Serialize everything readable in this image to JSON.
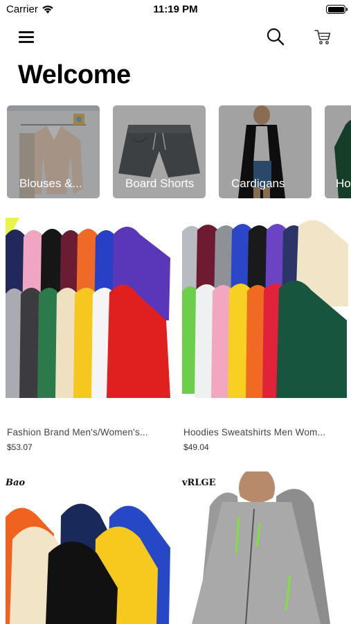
{
  "status_bar": {
    "carrier": "Carrier",
    "time": "11:19 PM"
  },
  "nav": {
    "menu_icon": "hamburger-menu-icon",
    "search_icon": "search-icon",
    "cart_icon": "cart-icon"
  },
  "header": {
    "title": "Welcome"
  },
  "categories": [
    {
      "label": "Blouses &...",
      "image": "blouse-photo"
    },
    {
      "label": "Board Shorts",
      "image": "shorts-photo"
    },
    {
      "label": "Cardigans",
      "image": "cardigan-photo"
    },
    {
      "label": "Ho",
      "image": "hoodie-photo"
    }
  ],
  "products": [
    {
      "title": "Fashion Brand Men's/Women's...",
      "price": "$53.07",
      "image": "hoodie-rack-photo",
      "brand_mark": ""
    },
    {
      "title": "Hoodies Sweatshirts Men Wom...",
      "price": "$49.04",
      "image": "hoodie-rows-photo",
      "brand_mark": ""
    },
    {
      "title": "",
      "price": "",
      "image": "hoodie-stack-photo",
      "brand_mark": "Bao"
    },
    {
      "title": "",
      "price": "",
      "image": "gray-zip-hoodie-photo",
      "brand_mark": "vRLGE"
    }
  ],
  "colors": {
    "background": "#ffffff",
    "text": "#000000",
    "secondary_text": "#444444",
    "overlay": "rgba(0,0,0,0.32)"
  }
}
